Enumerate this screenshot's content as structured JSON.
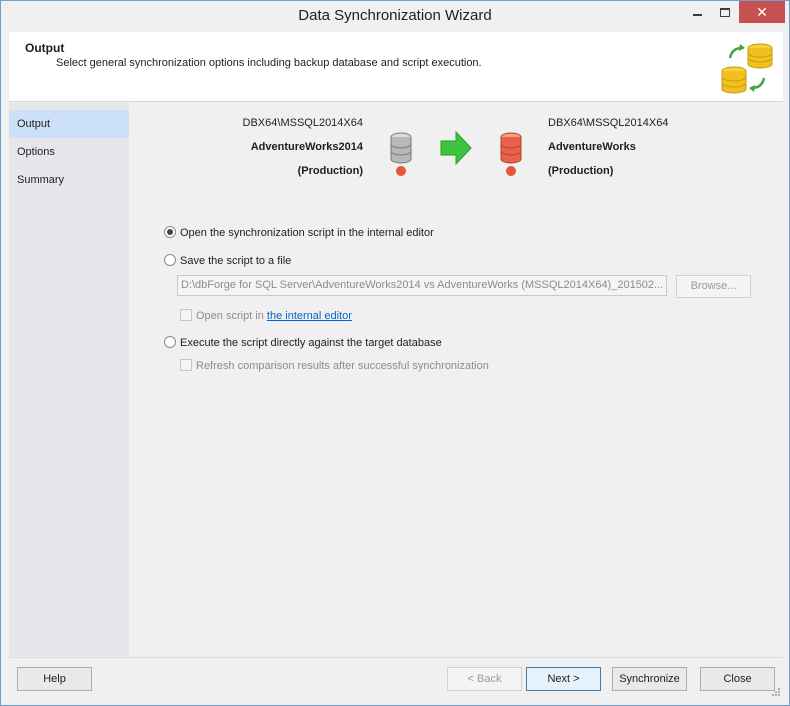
{
  "window": {
    "title": "Data Synchronization Wizard"
  },
  "header": {
    "title": "Output",
    "description": "Select general synchronization options including backup database and script execution."
  },
  "nav": {
    "items": [
      {
        "label": "Output",
        "active": true
      },
      {
        "label": "Options"
      },
      {
        "label": "Summary"
      }
    ]
  },
  "source": {
    "server": "DBX64\\MSSQL2014X64",
    "database": "AdventureWorks2014",
    "environment": "(Production)"
  },
  "target": {
    "server": "DBX64\\MSSQL2014X64",
    "database": "AdventureWorks",
    "environment": "(Production)"
  },
  "options": {
    "open_internal_editor": "Open the synchronization script in the internal editor",
    "save_to_file": "Save the script to a file",
    "file_path": "D:\\dbForge for SQL Server\\AdventureWorks2014 vs AdventureWorks (MSSQL2014X64)_201502...",
    "browse": "Browse...",
    "open_script_in": "Open script in ",
    "open_script_link": "the internal editor",
    "execute_directly": "Execute the script directly against the target database",
    "refresh_results": "Refresh comparison results after successful synchronization"
  },
  "footer": {
    "help": "Help",
    "back": "< Back",
    "next": "Next >",
    "synchronize": "Synchronize",
    "close": "Close"
  },
  "colors": {
    "accent": "#cce0f7",
    "link": "#0066cc",
    "arrow": "#3cc43c",
    "status_dot": "#e8553c",
    "close_button": "#c75050"
  }
}
